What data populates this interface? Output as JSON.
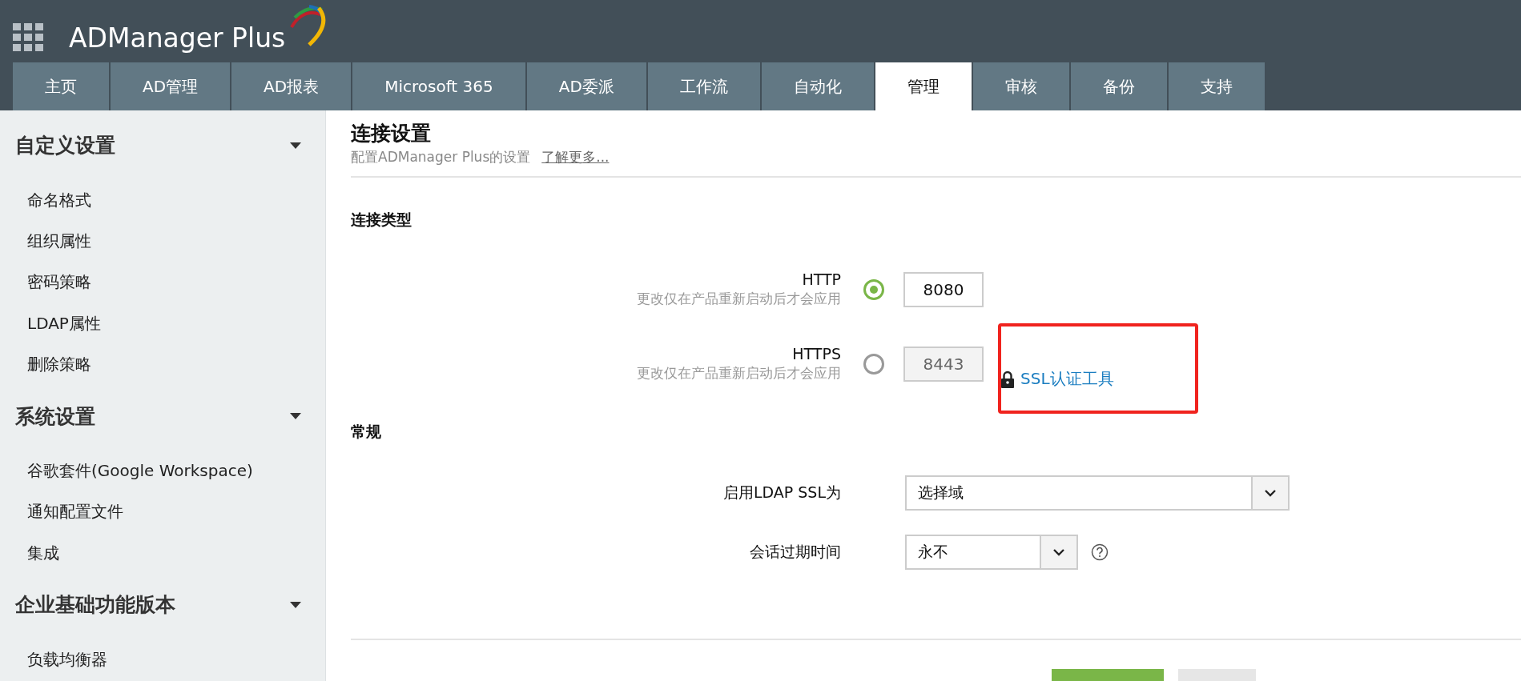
{
  "app": {
    "logo": "ADManager Plus"
  },
  "tabs": [
    {
      "label": "主页",
      "selected": false
    },
    {
      "label": "AD管理",
      "selected": false
    },
    {
      "label": "AD报表",
      "selected": false
    },
    {
      "label": "Microsoft 365",
      "selected": false
    },
    {
      "label": "AD委派",
      "selected": false
    },
    {
      "label": "工作流",
      "selected": false
    },
    {
      "label": "自动化",
      "selected": false
    },
    {
      "label": "管理",
      "selected": true
    },
    {
      "label": "审核",
      "selected": false
    },
    {
      "label": "备份",
      "selected": false
    },
    {
      "label": "支持",
      "selected": false
    }
  ],
  "sidebar": {
    "sections": [
      {
        "title": "自定义设置",
        "expanded": true,
        "items": [
          "命名格式",
          "组织属性",
          "密码策略",
          "LDAP属性",
          "删除策略"
        ]
      },
      {
        "title": "系统设置",
        "expanded": true,
        "items": [
          "谷歌套件(Google Workspace)",
          "通知配置文件",
          "集成"
        ]
      },
      {
        "title": "企业基础功能版本",
        "expanded": true,
        "items": [
          "负载均衡器"
        ]
      }
    ]
  },
  "page": {
    "title": "连接设置",
    "subtitle": "配置ADManager Plus的设置",
    "learn_more": "了解更多..."
  },
  "connection_type": {
    "heading": "连接类型",
    "options": [
      {
        "label": "HTTP",
        "note": "更改仅在产品重新启动后才会应用",
        "selected": true,
        "port": "8080",
        "disabled": false
      },
      {
        "label": "HTTPS",
        "note": "更改仅在产品重新启动后才会应用",
        "selected": false,
        "port": "8443",
        "disabled": true,
        "link": "SSL认证工具"
      }
    ]
  },
  "general": {
    "heading": "常规",
    "fields": [
      {
        "label": "启用LDAP SSL为",
        "value": "选择域",
        "kind": "wide",
        "help": false
      },
      {
        "label": "会话过期时间",
        "value": "永不",
        "kind": "narrow",
        "help": true
      }
    ]
  }
}
